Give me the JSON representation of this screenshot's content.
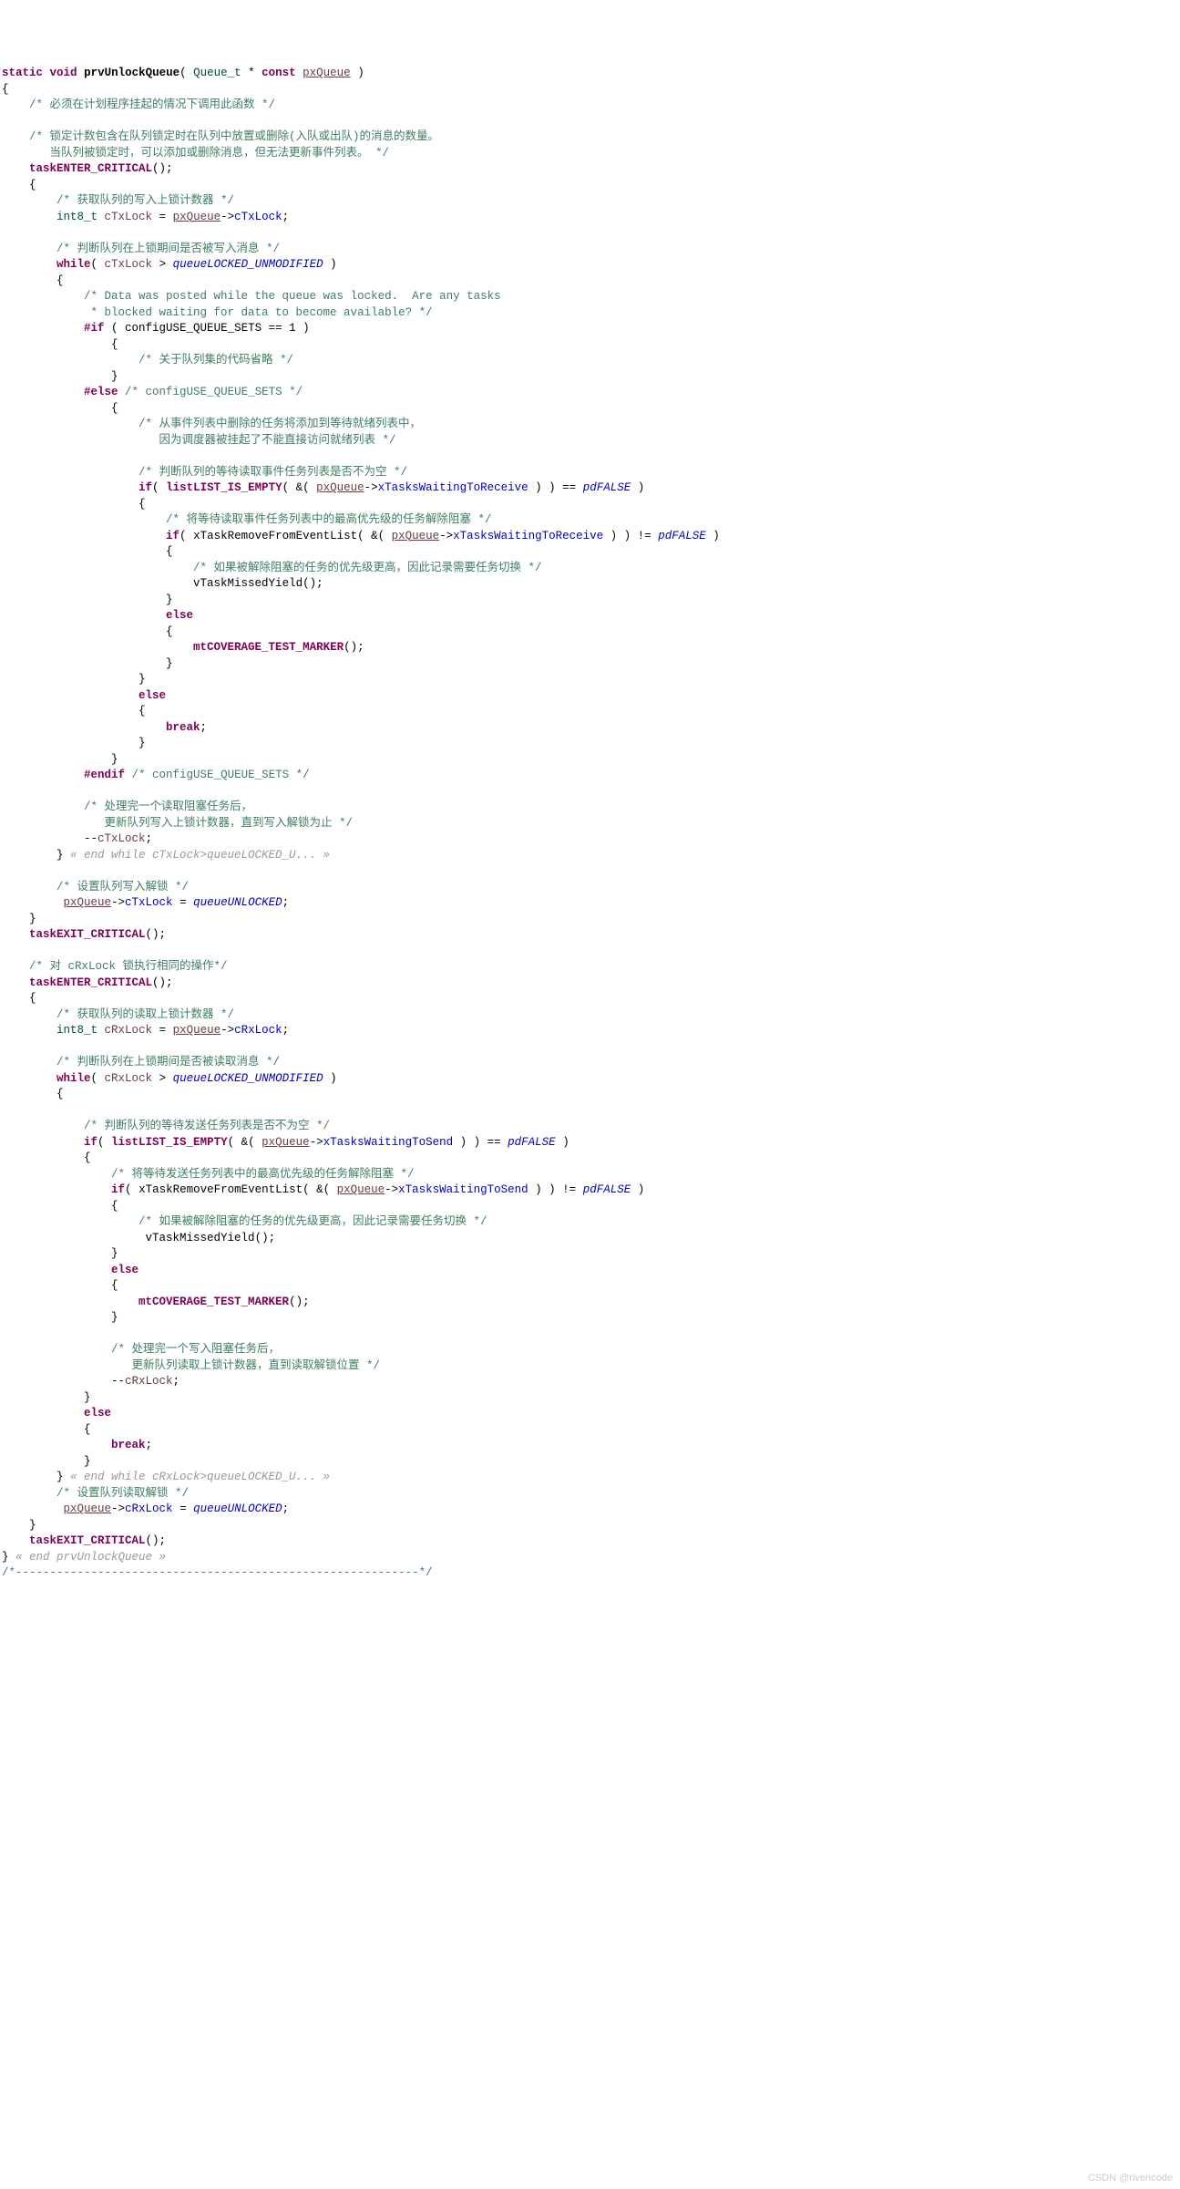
{
  "watermark": "CSDN @rivencode",
  "code": {
    "l1": {
      "kw1": "static",
      "kw2": "void",
      "fn": "prvUnlockQueue",
      "ty": "Queue_t",
      "kw3": "const",
      "param": "pxQueue"
    },
    "l4": "/* 必须在计划程序挂起的情况下调用此函数 */",
    "l6a": "/* 锁定计数包含在队列锁定时在队列中放置或删除(入队或出队)的消息的数量。",
    "l6b": "       当队列被锁定时，可以添加或删除消息，但无法更新事件列表。 */",
    "l7": "taskENTER_CRITICAL",
    "l9": "/* 获取队列的写入上锁计数器 */",
    "l10": {
      "ty": "int8_t",
      "var": "cTxLock",
      "param": "pxQueue",
      "field": "cTxLock"
    },
    "l12": "/* 判断队列在上锁期间是否被写入消息 */",
    "l13": {
      "kw": "while",
      "var": "cTxLock",
      "const": "queueLOCKED_UNMODIFIED"
    },
    "l15a": "/* Data was posted while the queue was locked.  Are any tasks",
    "l15b": "             * blocked waiting for data to become available? */",
    "l16": {
      "pp": "#if",
      "cond": "configUSE_QUEUE_SETS == 1"
    },
    "l18": "/* 关于队列集的代码省略 */",
    "l20": {
      "pp": "#else",
      "cm": "/* configUSE_QUEUE_SETS */"
    },
    "l22a": "/* 从事件列表中删除的任务将添加到等待就绪列表中，",
    "l22b": "                       因为调度器被挂起了不能直接访问就绪列表 */",
    "l24": "/* 判断队列的等待读取事件任务列表是否不为空 */",
    "l25": {
      "kw": "if",
      "mac": "listLIST_IS_EMPTY",
      "param": "pxQueue",
      "field": "xTasksWaitingToReceive",
      "const": "pdFALSE"
    },
    "l27": "/* 将等待读取事件任务列表中的最高优先级的任务解除阻塞 */",
    "l28": {
      "kw": "if",
      "fn": "xTaskRemoveFromEventList",
      "param": "pxQueue",
      "field": "xTasksWaitingToReceive",
      "const": "pdFALSE"
    },
    "l30": "/* 如果被解除阻塞的任务的优先级更高，因此记录需要任务切换 */",
    "l31": "vTaskMissedYield",
    "l33": "else",
    "l35": "mtCOVERAGE_TEST_MARKER",
    "l38": "else",
    "l40": "break",
    "l43": {
      "pp": "#endif",
      "cm": "/* configUSE_QUEUE_SETS */"
    },
    "l45a": "/* 处理完一个读取阻塞任务后，",
    "l45b": "               更新队列写入上锁计数器，直到写入解锁为止 */",
    "l46": "cTxLock",
    "l47": "« end while cTxLock>queueLOCKED_U... »",
    "l49": "/* 设置队列写入解锁 */",
    "l50": {
      "param": "pxQueue",
      "field": "cTxLock",
      "const": "queueUNLOCKED"
    },
    "l52": "taskEXIT_CRITICAL",
    "l54": "/* 对 cRxLock 锁执行相同的操作*/",
    "l55": "taskENTER_CRITICAL",
    "l57": "/* 获取队列的读取上锁计数器 */",
    "l58": {
      "ty": "int8_t",
      "var": "cRxLock",
      "param": "pxQueue",
      "field": "cRxLock"
    },
    "l60": "/* 判断队列在上锁期间是否被读取消息 */",
    "l61": {
      "kw": "while",
      "var": "cRxLock",
      "const": "queueLOCKED_UNMODIFIED"
    },
    "l64": "/* 判断队列的等待发送任务列表是否不为空 */",
    "l65": {
      "kw": "if",
      "mac": "listLIST_IS_EMPTY",
      "param": "pxQueue",
      "field": "xTasksWaitingToSend",
      "const": "pdFALSE"
    },
    "l67": "/* 将等待发送任务列表中的最高优先级的任务解除阻塞 */",
    "l68": {
      "kw": "if",
      "fn": "xTaskRemoveFromEventList",
      "param": "pxQueue",
      "field": "xTasksWaitingToSend",
      "const": "pdFALSE"
    },
    "l70": "/* 如果被解除阻塞的任务的优先级更高，因此记录需要任务切换 */",
    "l71": "vTaskMissedYield",
    "l73": "else",
    "l75": "mtCOVERAGE_TEST_MARKER",
    "l78a": "/* 处理完一个写入阻塞任务后，",
    "l78b": "                   更新队列读取上锁计数器，直到读取解锁位置 */",
    "l79": "cRxLock",
    "l81": "else",
    "l83": "break",
    "l86": "« end while cRxLock>queueLOCKED_U... »",
    "l87": "/* 设置队列读取解锁 */",
    "l88": {
      "param": "pxQueue",
      "field": "cRxLock",
      "const": "queueUNLOCKED"
    },
    "l90": "taskEXIT_CRITICAL",
    "l91": "« end prvUnlockQueue »",
    "l92": "/*-----------------------------------------------------------*/"
  }
}
